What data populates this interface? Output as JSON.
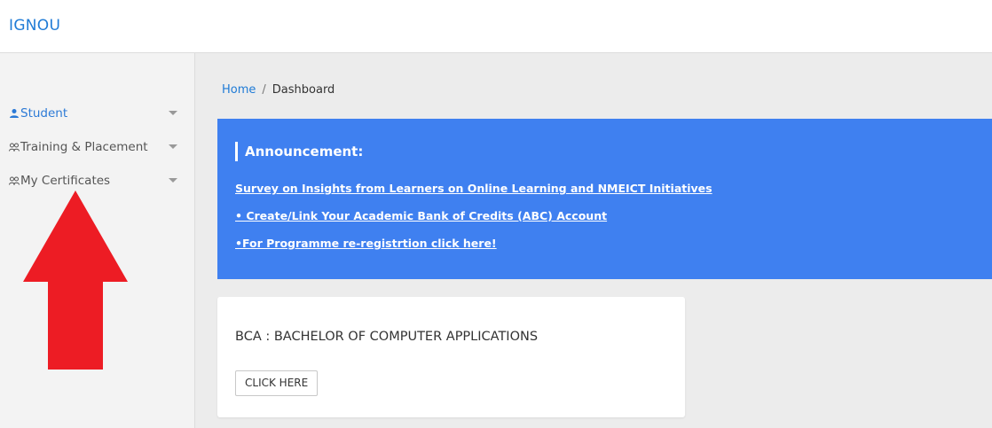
{
  "header": {
    "brand": "IGNOU"
  },
  "sidebar": {
    "items": [
      {
        "label": "Student",
        "icon": "person-icon",
        "active": true
      },
      {
        "label": "Training & Placement",
        "icon": "people-icon",
        "active": false
      },
      {
        "label": "My Certificates",
        "icon": "people-icon",
        "active": false
      }
    ]
  },
  "breadcrumb": {
    "home": "Home",
    "separator": "/",
    "current": "Dashboard"
  },
  "announcement": {
    "title": "Announcement:",
    "links": [
      "Survey on Insights from Learners on Online Learning and NMEICT Initiatives",
      "• Create/Link Your Academic Bank of Credits (ABC) Account",
      "•For Programme re-registrtion click here!"
    ],
    "bg_color": "#3f80f0"
  },
  "programme_card": {
    "title": "BCA : BACHELOR OF COMPUTER APPLICATIONS",
    "button_label": "CLICK HERE"
  },
  "colors": {
    "accent": "#1f7bd6",
    "annotation_arrow": "#ed1c24"
  }
}
